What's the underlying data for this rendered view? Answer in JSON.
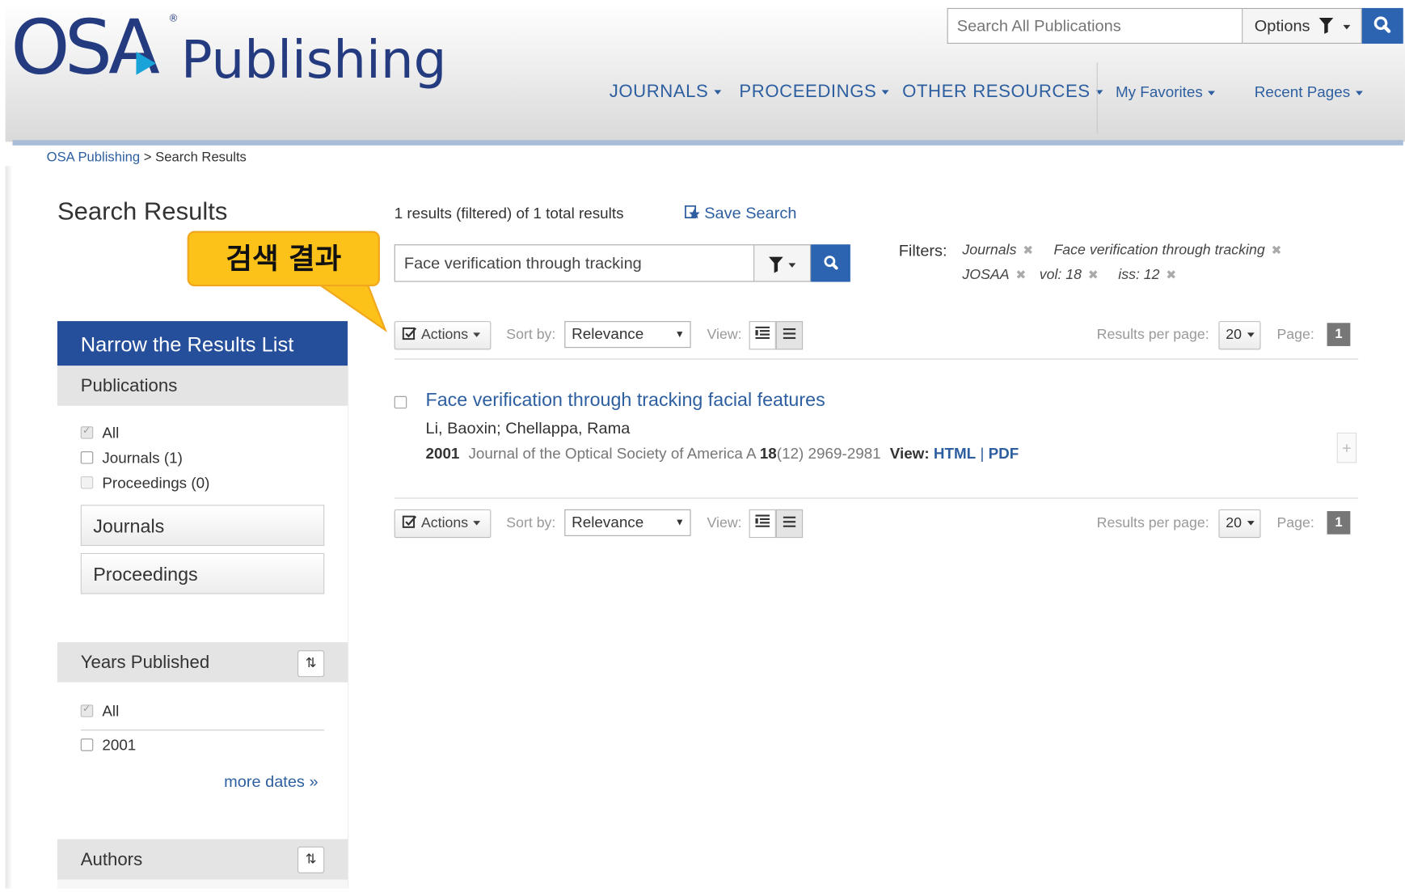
{
  "header": {
    "logo_osa": "OSA",
    "logo_reg": "®",
    "logo_publishing": "Publishing",
    "search_placeholder": "Search All Publications",
    "options_label": "Options",
    "nav": [
      "JOURNALS",
      "PROCEEDINGS",
      "OTHER RESOURCES"
    ],
    "nav_right": [
      "My Favorites",
      "Recent Pages"
    ]
  },
  "breadcrumb": {
    "home": "OSA Publishing",
    "separator": " > ",
    "current": "Search Results"
  },
  "page_title": "Search Results",
  "callout_text": "검색 결과",
  "sidebar": {
    "heading": "Narrow the Results List",
    "publications": {
      "title": "Publications",
      "options": [
        {
          "label": "All",
          "state": "checked"
        },
        {
          "label": "Journals (1)",
          "state": "unchecked"
        },
        {
          "label": "Proceedings (0)",
          "state": "disabled"
        }
      ],
      "buttons": [
        "Journals",
        "Proceedings"
      ]
    },
    "years": {
      "title": "Years Published",
      "options": [
        {
          "label": "All",
          "state": "checked"
        },
        {
          "label": "2001",
          "state": "unchecked"
        }
      ],
      "more_link": "more dates »"
    },
    "authors": {
      "title": "Authors"
    },
    "sort_icon": "⇅"
  },
  "results_summary": "1 results (filtered) of 1 total results",
  "save_search_label": "Save Search",
  "search_query": "Face verification through tracking",
  "filters": {
    "label": "Filters:",
    "tags": [
      "Journals",
      "Face verification through tracking",
      "JOSAA",
      "vol: 18",
      "iss: 12"
    ],
    "remove_glyph": "✖"
  },
  "toolbar": {
    "actions_label": "Actions",
    "sort_label": "Sort by:",
    "sort_value": "Relevance",
    "view_label": "View:",
    "rpp_label": "Results per page:",
    "rpp_value": "20",
    "page_label": "Page:",
    "page_value": "1"
  },
  "result": {
    "title": "Face verification through tracking facial features",
    "authors": "Li, Baoxin; Chellappa, Rama",
    "year": "2001",
    "journal": "Journal of the Optical Society of America A",
    "volume": "18",
    "issue_pages": "(12) 2969-2981",
    "view_label": "View:",
    "html_link": "HTML",
    "link_sep": " | ",
    "pdf_link": "PDF",
    "expand_glyph": "+"
  },
  "colors": {
    "brand_blue": "#253b80",
    "link_blue": "#2d5fa0",
    "sidebar_header": "#264f9b",
    "search_button": "#2d64b2",
    "callout_fill": "#fdc21a"
  }
}
